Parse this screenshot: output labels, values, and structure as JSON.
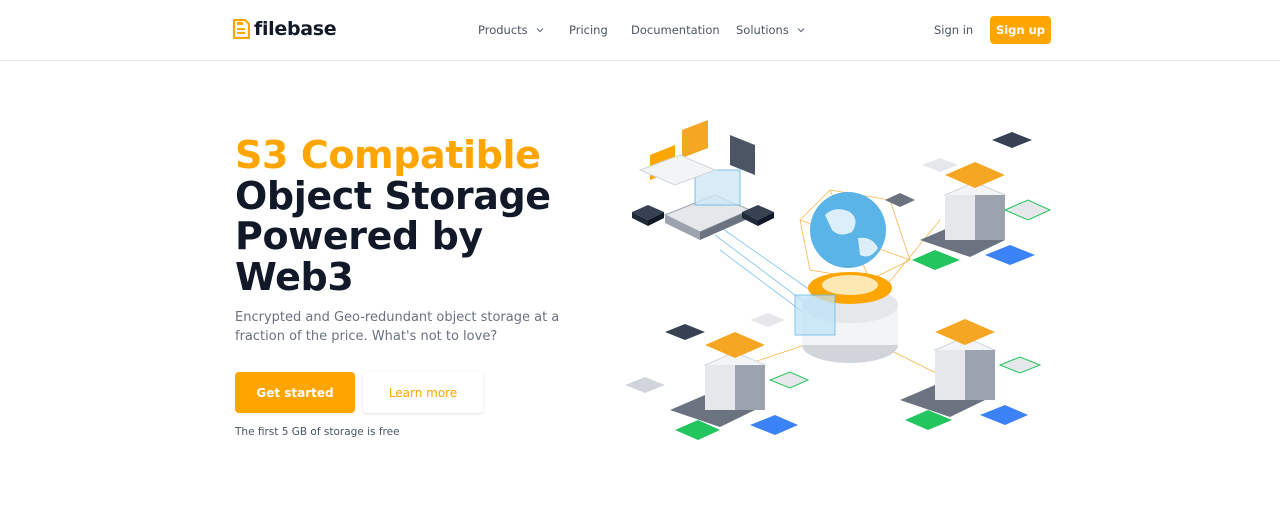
{
  "brand": {
    "name": "filebase",
    "accent_color": "#ffa500",
    "logo_icon": "floppy-disk-icon"
  },
  "nav": {
    "items": [
      {
        "label": "Products",
        "has_dropdown": true
      },
      {
        "label": "Pricing",
        "has_dropdown": false
      },
      {
        "label": "Documentation",
        "has_dropdown": false
      },
      {
        "label": "Solutions",
        "has_dropdown": true
      }
    ],
    "sign_in": "Sign in",
    "sign_up": "Sign up"
  },
  "hero": {
    "title_accent": "S3 Compatible",
    "title_line_1": "Object Storage",
    "title_line_2": "Powered by",
    "title_line_3": "Web3",
    "subtitle": "Encrypted and Geo-redundant object storage at a fraction of the price. What's not to love?",
    "primary_cta": "Get started",
    "secondary_cta": "Learn more",
    "note": "The first 5 GB of storage is free"
  }
}
